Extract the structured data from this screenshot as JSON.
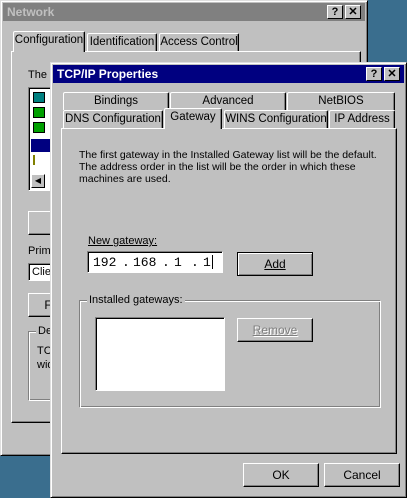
{
  "network": {
    "title": "Network",
    "help_btn": "?",
    "close_btn": "✕",
    "tabs": [
      "Configuration",
      "Identification",
      "Access Control"
    ],
    "the_label": "The",
    "primary_label": "Prima",
    "primary_value": "Clie",
    "button_f": "F",
    "desc_group": "De",
    "desc_text1": "TC",
    "desc_text2": "wid"
  },
  "dialog": {
    "title": "TCP/IP Properties",
    "help_btn": "?",
    "close_btn": "✕",
    "tabs_row1": [
      "Bindings",
      "Advanced",
      "NetBIOS"
    ],
    "tabs_row2": [
      "DNS Configuration",
      "Gateway",
      "WINS Configuration",
      "IP Address"
    ],
    "description": "The first gateway in the Installed Gateway list will be the default. The address order in the list will be the order in which these machines are used.",
    "new_gateway_label": "New gateway:",
    "ip_octets": [
      "192",
      "168",
      "1",
      "1"
    ],
    "add_button": "Add",
    "installed_label": "Installed gateways:",
    "remove_button": "Remove",
    "ok_button": "OK",
    "cancel_button": "Cancel"
  }
}
